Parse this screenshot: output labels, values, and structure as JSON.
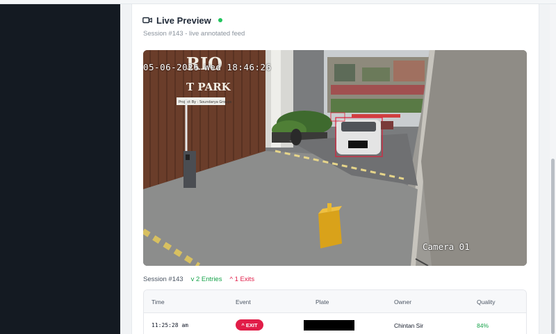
{
  "preview": {
    "title": "Live Preview",
    "subtitle": "Session #143 - live annotated feed",
    "live_color": "#22c55e",
    "icon": "video-camera-icon"
  },
  "video": {
    "timestamp": "05-06-2026 Wed 18:46:26",
    "camera_label": "Camera 01",
    "sign_text": "RIO",
    "sign_subtext": "T PARK",
    "sign_plaque": "Project By : Soundarya Groups",
    "detection_color": "#e0203a"
  },
  "stats": {
    "session": "Session #143",
    "entries": "v 2 Entries",
    "exits": "^ 1 Exits"
  },
  "table": {
    "columns": [
      "Time",
      "Event",
      "Plate",
      "Owner",
      "Quality"
    ],
    "rows": [
      {
        "time": "11:25:28 am",
        "event": "^ EXIT",
        "plate": "",
        "owner": "Chintan Sir",
        "quality": "84%"
      }
    ]
  }
}
